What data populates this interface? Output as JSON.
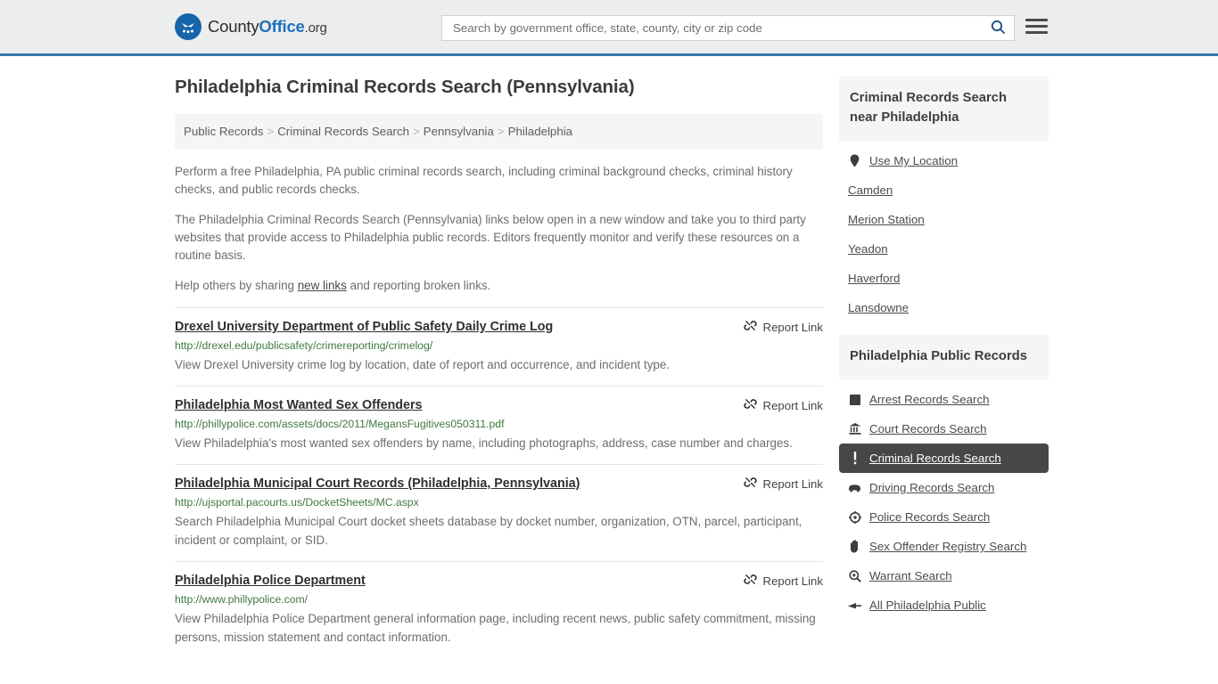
{
  "header": {
    "logo": {
      "text_part1": "County",
      "text_part2": "Office",
      "text_part3": ".org"
    },
    "search": {
      "placeholder": "Search by government office, state, county, city or zip code",
      "value": ""
    },
    "accent_color": "#3b77ad",
    "logo_blue": "#1f6fbe"
  },
  "main": {
    "title": "Philadelphia Criminal Records Search (Pennsylvania)",
    "breadcrumb": [
      "Public Records",
      "Criminal Records Search",
      "Pennsylvania",
      "Philadelphia"
    ],
    "breadcrumb_separator": ">",
    "intro": {
      "p1": "Perform a free Philadelphia, PA public criminal records search, including criminal background checks, criminal history checks, and public records checks.",
      "p2": "The Philadelphia Criminal Records Search (Pennsylvania) links below open in a new window and take you to third party websites that provide access to Philadelphia public records. Editors frequently monitor and verify these resources on a routine basis.",
      "p3_before": "Help others by sharing ",
      "p3_link": "new links",
      "p3_after": " and reporting broken links."
    },
    "report_link_label": "Report Link",
    "results": [
      {
        "title": "Drexel University Department of Public Safety Daily Crime Log",
        "url": "http://drexel.edu/publicsafety/crimereporting/crimelog/",
        "description": "View Drexel University crime log by location, date of report and occurrence, and incident type."
      },
      {
        "title": "Philadelphia Most Wanted Sex Offenders",
        "url": "http://phillypolice.com/assets/docs/2011/MegansFugitives050311.pdf",
        "description": "View Philadelphia's most wanted sex offenders by name, including photographs, address, case number and charges."
      },
      {
        "title": "Philadelphia Municipal Court Records (Philadelphia, Pennsylvania)",
        "url": "http://ujsportal.pacourts.us/DocketSheets/MC.aspx",
        "description": "Search Philadelphia Municipal Court docket sheets database by docket number, organization, OTN, parcel, participant, incident or complaint, or SID."
      },
      {
        "title": "Philadelphia Police Department",
        "url": "http://www.phillypolice.com/",
        "description": "View Philadelphia Police Department general information page, including recent news, public safety commitment, missing persons, mission statement and contact information."
      }
    ]
  },
  "sidebar": {
    "nearby": {
      "title": "Criminal Records Search near Philadelphia",
      "items": [
        {
          "label": "Use My Location",
          "icon": "map-pin-icon"
        },
        {
          "label": "Camden",
          "icon": ""
        },
        {
          "label": "Merion Station",
          "icon": ""
        },
        {
          "label": "Yeadon",
          "icon": ""
        },
        {
          "label": "Haverford",
          "icon": ""
        },
        {
          "label": "Lansdowne",
          "icon": ""
        }
      ]
    },
    "public_records": {
      "title": "Philadelphia Public Records",
      "active_highlight_color": "#474747",
      "items": [
        {
          "label": "Arrest Records Search",
          "icon": "square-icon",
          "active": false
        },
        {
          "label": "Court Records Search",
          "icon": "courthouse-icon",
          "active": false
        },
        {
          "label": "Criminal Records Search",
          "icon": "exclamation-icon",
          "active": true
        },
        {
          "label": "Driving Records Search",
          "icon": "car-icon",
          "active": false
        },
        {
          "label": "Police Records Search",
          "icon": "target-icon",
          "active": false
        },
        {
          "label": "Sex Offender Registry Search",
          "icon": "hand-icon",
          "active": false
        },
        {
          "label": "Warrant Search",
          "icon": "magnifier-plus-icon",
          "active": false
        },
        {
          "label": "All Philadelphia Public",
          "icon": "arrow-right-icon",
          "active": false
        }
      ]
    }
  }
}
